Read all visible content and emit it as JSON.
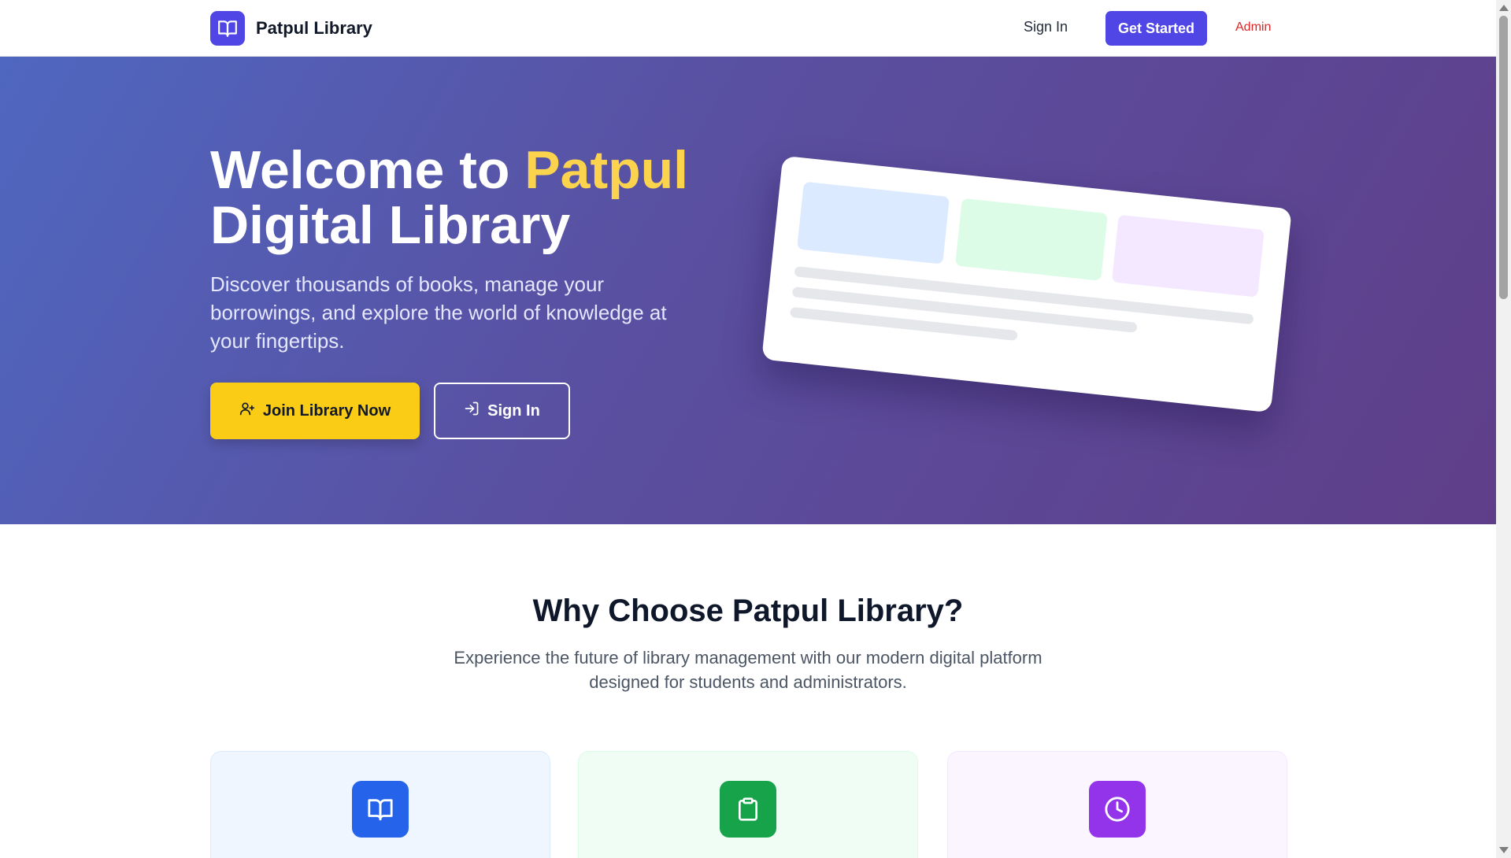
{
  "nav": {
    "brand_name": "Patpul Library",
    "brand_icon": "book-open-icon",
    "sign_in": "Sign In",
    "get_started": "Get Started",
    "admin": "Admin"
  },
  "hero": {
    "title_prefix": "Welcome to ",
    "title_accent": "Patpul",
    "title_line2": "Digital Library",
    "description": "Discover thousands of books, manage your borrowings, and explore the world of knowledge at your fingertips.",
    "join_button": "Join Library Now",
    "join_icon": "user-plus-icon",
    "signin_button": "Sign In",
    "signin_icon": "sign-in-icon"
  },
  "features": {
    "title": "Why Choose Patpul Library?",
    "subtitle": "Experience the future of library management with our modern digital platform designed for students and administrators.",
    "cards": [
      {
        "icon": "book-open-icon",
        "color": "#2563eb"
      },
      {
        "icon": "clipboard-icon",
        "color": "#16a34a"
      },
      {
        "icon": "clock-icon",
        "color": "#9333ea"
      }
    ]
  },
  "colors": {
    "primary": "#4f46e5",
    "accent_yellow": "#facc15",
    "admin_red": "#dc2626"
  }
}
